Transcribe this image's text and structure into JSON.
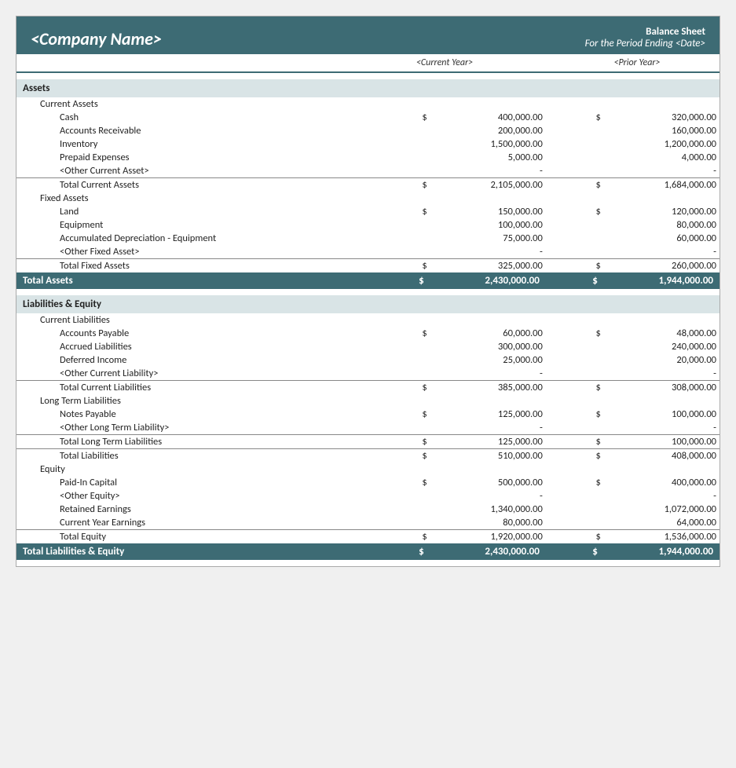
{
  "header": {
    "company_name": "<Company Name>",
    "report_title": "Balance Sheet",
    "report_subtitle": "For the Period Ending <Date>",
    "col_cy": "<Current Year>",
    "col_py": "<Prior Year>"
  },
  "sections": {
    "assets_label": "Assets",
    "current_assets_label": "Current Assets",
    "fixed_assets_label": "Fixed Assets",
    "liabilities_equity_label": "Liabilities & Equity",
    "current_liabilities_label": "Current Liabilities",
    "long_term_liabilities_label": "Long Term Liabilities",
    "equity_label": "Equity"
  },
  "rows": {
    "cash": "Cash",
    "accounts_receivable": "Accounts Receivable",
    "inventory": "Inventory",
    "prepaid_expenses": "Prepaid Expenses",
    "other_current_asset": "<Other Current Asset>",
    "total_current_assets": "Total Current Assets",
    "land": "Land",
    "equipment": "Equipment",
    "accum_depreciation": "Accumulated Depreciation - Equipment",
    "other_fixed_asset": "<Other Fixed Asset>",
    "total_fixed_assets": "Total Fixed Assets",
    "total_assets": "Total Assets",
    "accounts_payable": "Accounts Payable",
    "accrued_liabilities": "Accrued Liabilities",
    "deferred_income": "Deferred Income",
    "other_current_liability": "<Other Current Liability>",
    "total_current_liabilities": "Total Current Liabilities",
    "notes_payable": "Notes Payable",
    "other_lt_liability": "<Other Long Term Liability>",
    "total_lt_liabilities": "Total Long Term Liabilities",
    "total_liabilities": "Total Liabilities",
    "paid_in_capital": "Paid-In Capital",
    "other_equity": "<Other Equity>",
    "retained_earnings": "Retained Earnings",
    "current_year_earnings": "Current Year Earnings",
    "total_equity": "Total Equity",
    "total_liabilities_equity": "Total Liabilities & Equity"
  },
  "values": {
    "cash_cy": "400,000.00",
    "cash_py": "320,000.00",
    "ar_cy": "200,000.00",
    "ar_py": "160,000.00",
    "inventory_cy": "1,500,000.00",
    "inventory_py": "1,200,000.00",
    "prepaid_cy": "5,000.00",
    "prepaid_py": "4,000.00",
    "other_ca_cy": "-",
    "other_ca_py": "-",
    "total_ca_cy": "2,105,000.00",
    "total_ca_py": "1,684,000.00",
    "land_cy": "150,000.00",
    "land_py": "120,000.00",
    "equipment_cy": "100,000.00",
    "equipment_py": "80,000.00",
    "accum_dep_cy": "75,000.00",
    "accum_dep_py": "60,000.00",
    "other_fa_cy": "-",
    "other_fa_py": "-",
    "total_fa_cy": "325,000.00",
    "total_fa_py": "260,000.00",
    "total_assets_cy": "2,430,000.00",
    "total_assets_py": "1,944,000.00",
    "ap_cy": "60,000.00",
    "ap_py": "48,000.00",
    "accr_liab_cy": "300,000.00",
    "accr_liab_py": "240,000.00",
    "deferred_cy": "25,000.00",
    "deferred_py": "20,000.00",
    "other_cl_cy": "-",
    "other_cl_py": "-",
    "total_cl_cy": "385,000.00",
    "total_cl_py": "308,000.00",
    "notes_cy": "125,000.00",
    "notes_py": "100,000.00",
    "other_lt_cy": "-",
    "other_lt_py": "-",
    "total_lt_cy": "125,000.00",
    "total_lt_py": "100,000.00",
    "total_liab_cy": "510,000.00",
    "total_liab_py": "408,000.00",
    "paid_in_cy": "500,000.00",
    "paid_in_py": "400,000.00",
    "other_eq_cy": "-",
    "other_eq_py": "-",
    "retained_cy": "1,340,000.00",
    "retained_py": "1,072,000.00",
    "cy_earn_cy": "80,000.00",
    "cy_earn_py": "64,000.00",
    "total_eq_cy": "1,920,000.00",
    "total_eq_py": "1,536,000.00",
    "total_le_cy": "2,430,000.00",
    "total_le_py": "1,944,000.00",
    "dollar": "$"
  }
}
